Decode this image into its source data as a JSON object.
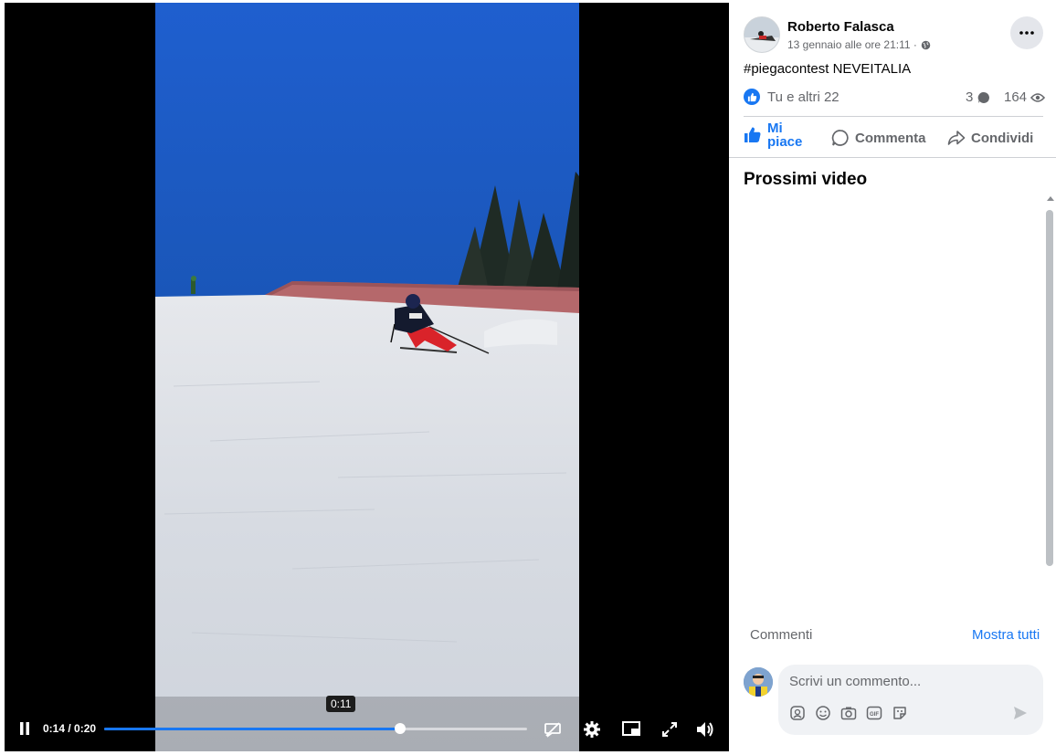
{
  "player": {
    "time_display": "0:14 / 0:20",
    "hover_time": "0:11",
    "progress": 0.7,
    "pause_icon": "pause-icon",
    "captions_icon": "captions-off-icon",
    "settings_icon": "gear-icon",
    "pip_icon": "picture-in-picture-icon",
    "fullscreen_icon": "fullscreen-icon",
    "volume_icon": "volume-icon",
    "accent": "#1877f2"
  },
  "post": {
    "author": "Roberto Falasca",
    "date": "13 gennaio alle ore 21:11 ·",
    "privacy_icon": "globe-icon",
    "text": "#piegacontest NEVEITALIA",
    "reactions_text": "Tu e altri 22",
    "comments_count": "3",
    "views_count": "164"
  },
  "actions": {
    "like": "Mi piace",
    "comment": "Commenta",
    "share": "Condividi"
  },
  "next_videos": {
    "title": "Prossimi video"
  },
  "comments": {
    "label": "Commenti",
    "show_all": "Mostra tutti",
    "placeholder": "Scrivi un commento..."
  }
}
